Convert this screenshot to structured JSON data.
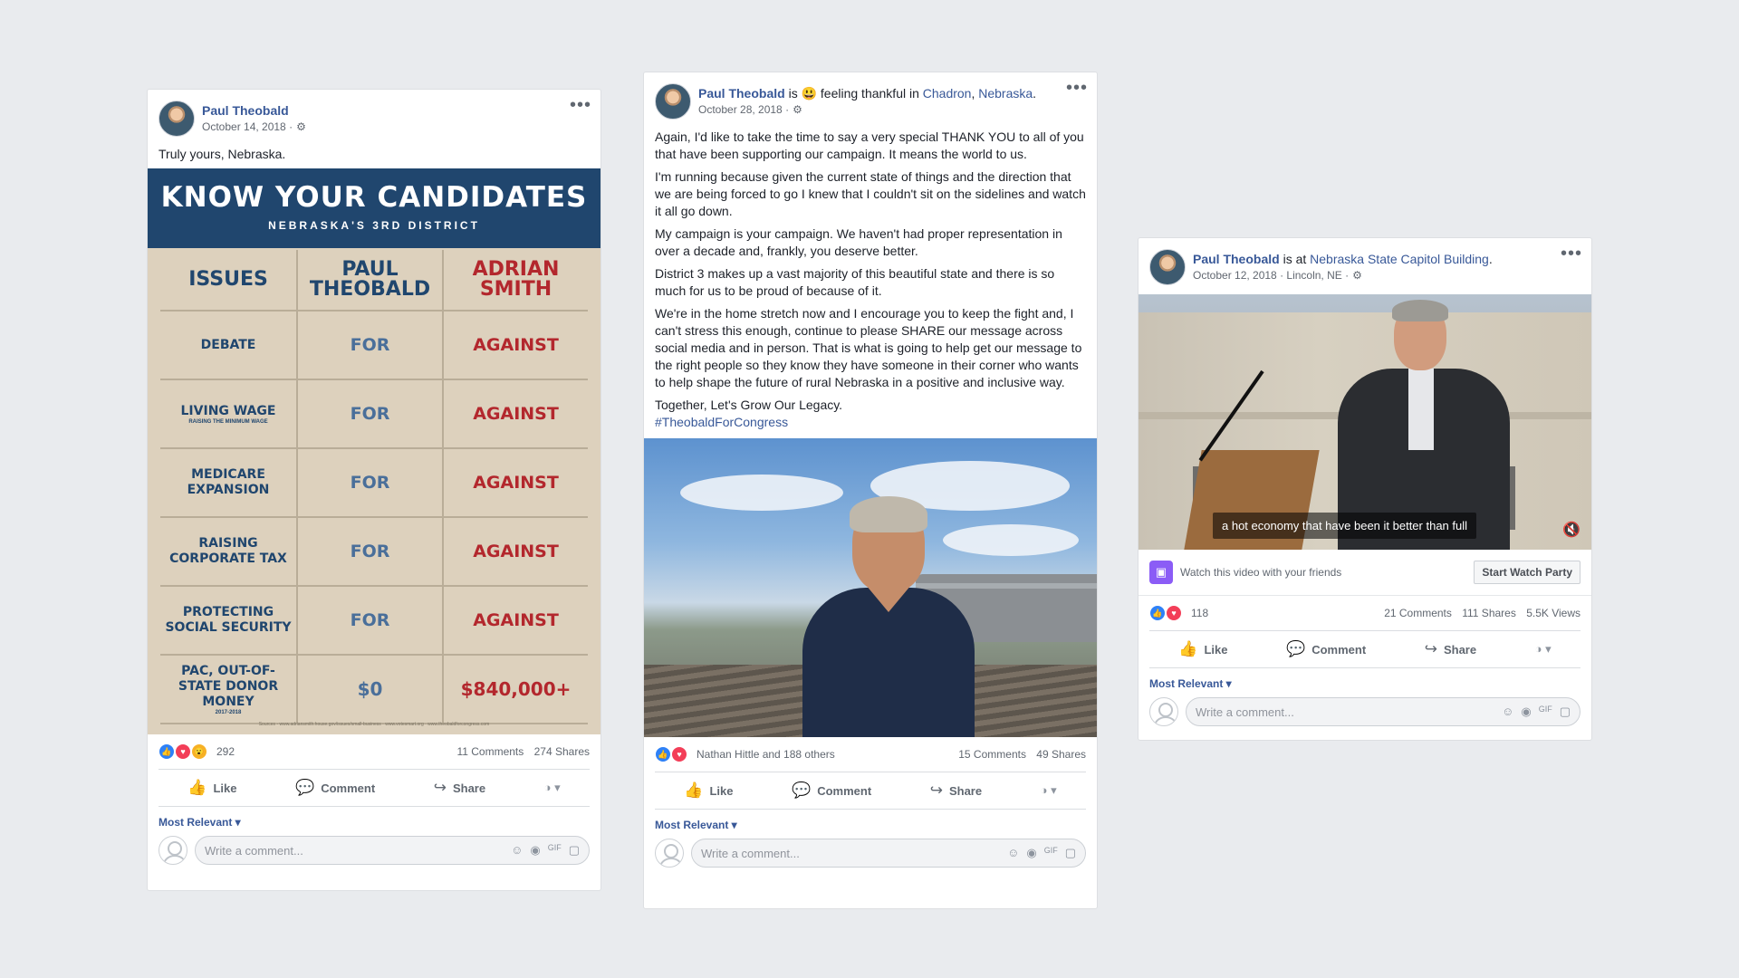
{
  "icons": {
    "gear": "⚙",
    "more": "•••",
    "like": "👍",
    "comment": "💬",
    "share": "↪",
    "audience": "◑ ▾",
    "smile": "☺",
    "camera": "◉",
    "gif": "GIF",
    "sticker": "▢",
    "mute": "🔇",
    "watch_party": "▣",
    "react_like": "👍",
    "react_love": "♥",
    "react_wow": "😮"
  },
  "post1": {
    "author": "Paul Theobald",
    "date": "October 14, 2018 ·",
    "text": "Truly yours, Nebraska.",
    "graphic": {
      "title": "KNOW YOUR CANDIDATES",
      "subtitle": "NEBRASKA'S 3RD DISTRICT",
      "headers": [
        "ISSUES",
        "PAUL\nTHEOBALD",
        "ADRIAN\nSMITH"
      ],
      "rows": [
        {
          "issue": "DEBATE",
          "note": "",
          "theobald": "FOR",
          "smith": "AGAINST"
        },
        {
          "issue": "LIVING WAGE",
          "note": "RAISING THE MINIMUM WAGE",
          "theobald": "FOR",
          "smith": "AGAINST"
        },
        {
          "issue": "MEDICARE EXPANSION",
          "note": "",
          "theobald": "FOR",
          "smith": "AGAINST"
        },
        {
          "issue": "RAISING CORPORATE TAX",
          "note": "",
          "theobald": "FOR",
          "smith": "AGAINST"
        },
        {
          "issue": "PROTECTING SOCIAL SECURITY",
          "note": "",
          "theobald": "FOR",
          "smith": "AGAINST"
        },
        {
          "issue": "PAC, OUT-OF-STATE DONOR MONEY",
          "note": "2017-2018",
          "theobald": "$0",
          "smith": "$840,000+"
        }
      ],
      "footnote": "Sources - www.adriansmith.house.gov/issues/small-business  ·  www.votesmart.org  ·  www.theobaldforcongress.com"
    },
    "reaction_count": "292",
    "comments": "11 Comments",
    "shares": "274 Shares"
  },
  "post2": {
    "author": "Paul Theobald",
    "is": " is ",
    "feeling_emoji": "😃",
    "feeling": " feeling thankful in ",
    "place1": "Chadron",
    "comma": ", ",
    "place2": "Nebraska",
    "dot": ".",
    "date": "October 28, 2018 ·",
    "paragraphs": [
      "Again, I'd like to take the time to say a very special THANK YOU to all of you that have been supporting our campaign. It means the world to us.",
      "I'm running because given the current state of things and the direction that we are being forced to go I knew that I couldn't sit on the sidelines and watch it all go down.",
      "My campaign is your campaign. We haven't had proper representation in over a decade and, frankly, you deserve better.",
      "District 3 makes up a vast majority of this beautiful state and there is so much for us to be proud of because of it.",
      "We're in the home stretch now and I encourage you to keep the fight and, I can't stress this enough, continue to please SHARE our message across social media and in person. That is what is going to help get our message to the right people so they know they have someone in their corner who wants to help shape the future of rural Nebraska in a positive and inclusive way.",
      "Together, Let's Grow Our Legacy."
    ],
    "hashtag": "#TheobaldForCongress",
    "reactors": "Nathan Hittle and 188 others",
    "comments": "15 Comments",
    "shares": "49 Shares"
  },
  "post3": {
    "author": "Paul Theobald",
    "is_at": " is at ",
    "place": "Nebraska State Capitol Building",
    "dot": ".",
    "date": "October 12, 2018 · Lincoln, NE ·",
    "caption": "a hot economy that have been it better than full",
    "watch_text": "Watch this video with your friends",
    "watch_button": "Start Watch Party",
    "reaction_count": "118",
    "comments": "21 Comments",
    "shares": "111 Shares",
    "views": "5.5K Views"
  },
  "common": {
    "like": "Like",
    "comment": "Comment",
    "share": "Share",
    "most_relevant": "Most Relevant ▾",
    "write_comment": "Write a comment..."
  }
}
